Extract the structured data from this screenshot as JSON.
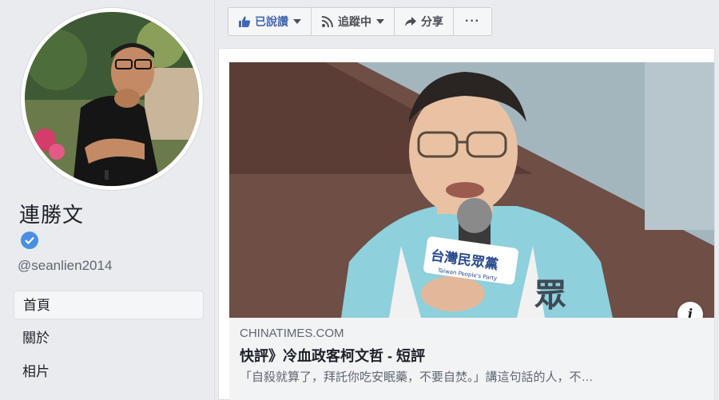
{
  "profile": {
    "name": "連勝文",
    "handle": "@seanlien2014",
    "verified": true
  },
  "nav": {
    "items": [
      {
        "label": "首頁",
        "active": true
      },
      {
        "label": "關於",
        "active": false
      },
      {
        "label": "相片",
        "active": false
      }
    ]
  },
  "toolbar": {
    "like_label": "已說讚",
    "follow_label": "追蹤中",
    "share_label": "分享",
    "more_label": "···"
  },
  "post": {
    "link": {
      "domain": "CHINATIMES.COM",
      "title": "快評》冷血政客柯文哲 - 短評",
      "description": "「自殺就算了，拜託你吃安眠藥，不要自焚。」講這句話的人，不…",
      "info_icon_label": "i"
    },
    "image_caption": {
      "party_logo_text": "台灣民眾黨",
      "party_logo_subtext": "Taiwan People's Party",
      "vest_text": "眾"
    }
  },
  "colors": {
    "accent": "#4267b2",
    "verified": "#4a90e2",
    "vest": "#7fc8d4",
    "page_bg": "#e9ebee"
  }
}
